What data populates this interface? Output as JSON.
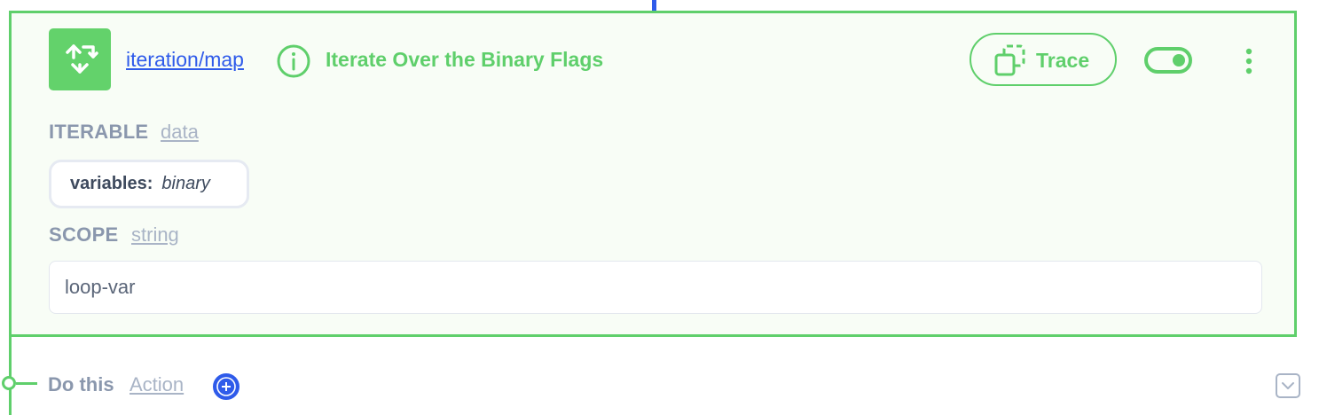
{
  "step": {
    "module": "iteration/map",
    "title": "Iterate Over the Binary Flags",
    "icon": "recycle-arrows-icon",
    "trace_label": "Trace",
    "toggle_on": true
  },
  "fields": {
    "iterable": {
      "label": "ITERABLE",
      "type": "data",
      "value_key": "variables:",
      "value_text": "binary"
    },
    "scope": {
      "label": "SCOPE",
      "type": "string",
      "value": "loop-var"
    }
  },
  "branch": {
    "label": "Do this",
    "type": "Action"
  },
  "colors": {
    "accent_green": "#5fcf6b",
    "link_blue": "#2f5bea",
    "muted_text": "#8a97ad",
    "card_bg": "#f8fdf6"
  }
}
